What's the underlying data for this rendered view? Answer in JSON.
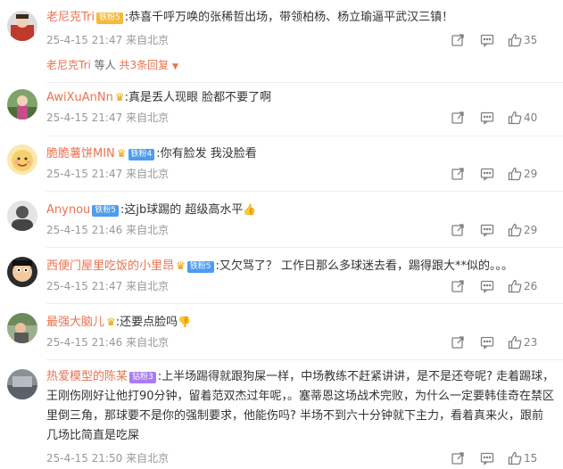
{
  "comments": [
    {
      "username": "老尼克Tri",
      "badge": "铁粉5",
      "text": ":恭喜千呼万唤的张稀哲出场，带领柏杨、杨立瑜逼平武汉三镇！",
      "time": "25-4-15 21:47",
      "location": "来自北京",
      "likes": "35",
      "replies": {
        "name": "老尼克Tri",
        "suffix": "等人",
        "link": "共3条回复"
      }
    },
    {
      "username": "AwiXuAnNn",
      "text": ":真是丢人现眼 脸都不要了啊",
      "time": "25-4-15 21:47",
      "location": "来自北京",
      "likes": "40"
    },
    {
      "username": "脆脆薯饼MIN",
      "badge": "铁粉4",
      "text": ":你有脸发 我没脸看",
      "time": "25-4-15 21:47",
      "location": "来自北京",
      "likes": "29"
    },
    {
      "username": "Anynou",
      "badge": "铁粉5",
      "text": ":这jb球踢的 超级高水平",
      "emoji": "👍",
      "time": "25-4-15 21:46",
      "location": "来自北京",
      "likes": "29"
    },
    {
      "username": "西便门屋里吃饭的小里昂",
      "badge": "铁粉5",
      "text": ":又欠骂了？ 工作日那么多球迷去看，踢得跟大**似的。。。",
      "time": "25-4-15 21:47",
      "location": "来自北京",
      "likes": "26"
    },
    {
      "username": "最强大脑儿",
      "text": ":还要点脸吗",
      "emoji": "👎",
      "time": "25-4-15 21:46",
      "location": "来自北京",
      "likes": "23"
    },
    {
      "username": "热爱模型的陈某",
      "badge": "钻粉3",
      "text": ":上半场踢得就跟狗屎一样，中场教练不赶紧讲讲，是不是还夸呢? 走着踢球，王刚伤刚好让他打90分钟，留着范双杰过年呢，。塞蒂恩这场战术完败，为什么一定要韩佳奇在禁区里倒三角，那球要不是你的强制要求，他能伤吗? 半场不到六十分钟就下主力，看着真来火，跟前几场比简直是吃屎",
      "time": "25-4-15 21:50",
      "location": "来自北京",
      "likes": "15"
    }
  ],
  "icons": [
    "share-icon",
    "comment-icon",
    "like-icon",
    "crown-icon"
  ],
  "colors": {
    "username": "#eb7350",
    "meta": "#999999",
    "text": "#333333"
  }
}
